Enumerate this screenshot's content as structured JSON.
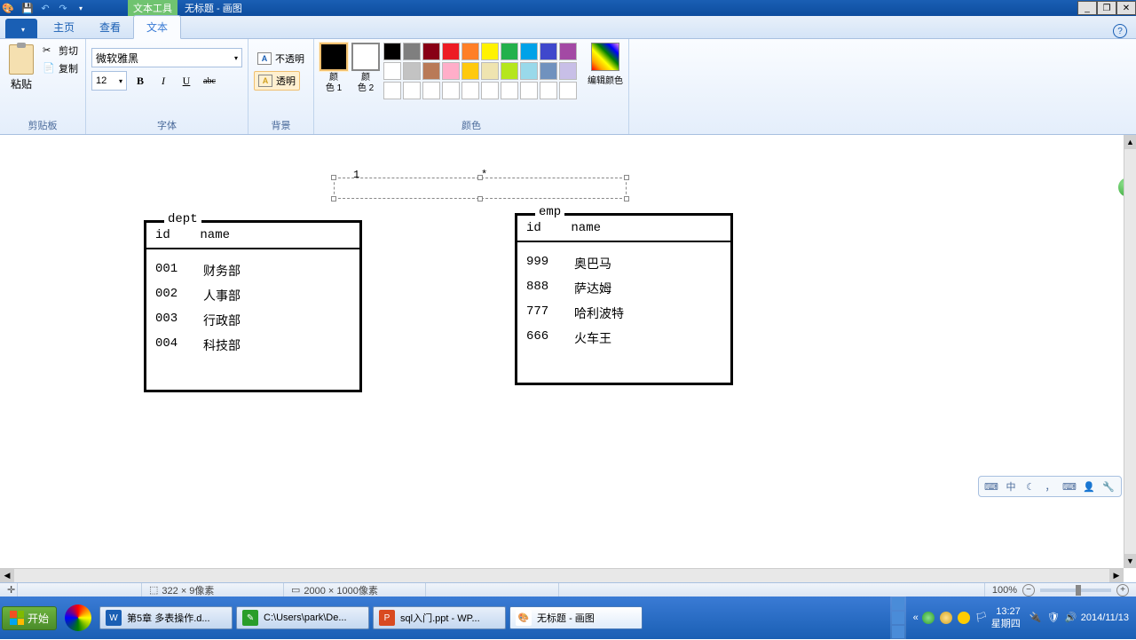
{
  "titlebar": {
    "text_tool": "文本工具",
    "title": "无标题 - 画图"
  },
  "tabs": {
    "home": "主页",
    "view": "查看",
    "text": "文本"
  },
  "clipboard": {
    "paste": "粘贴",
    "cut": "剪切",
    "copy": "复制",
    "label": "剪贴板"
  },
  "font": {
    "family": "微软雅黑",
    "size": "12",
    "label": "字体"
  },
  "bg": {
    "opaque": "不透明",
    "transparent": "透明",
    "label": "背景"
  },
  "colors": {
    "c1": "颜\n色 1",
    "c2": "颜\n色 2",
    "edit": "编辑颜色",
    "label": "颜色"
  },
  "canvas": {
    "rel1": "1",
    "relstar": "*",
    "dept": {
      "title": "dept",
      "header": "id    name",
      "rows": [
        {
          "id": "001",
          "name": "财务部"
        },
        {
          "id": "002",
          "name": "人事部"
        },
        {
          "id": "003",
          "name": "行政部"
        },
        {
          "id": "004",
          "name": "科技部"
        }
      ]
    },
    "emp": {
      "title": "emp",
      "header": "id    name",
      "rows": [
        {
          "id": "999",
          "name": "奥巴马"
        },
        {
          "id": "888",
          "name": "萨达姆"
        },
        {
          "id": "777",
          "name": "哈利波特"
        },
        {
          "id": "666",
          "name": "火车王"
        }
      ]
    }
  },
  "status": {
    "cursor": "",
    "sel": "322 × 9像素",
    "dim": "2000 × 1000像素",
    "zoom": "100%"
  },
  "taskbar": {
    "start": "开始",
    "items": [
      {
        "label": "第5章 多表操作.d...",
        "color": "#1a5fb4",
        "glyph": "W"
      },
      {
        "label": "C:\\Users\\park\\De...",
        "color": "#2a9d2a",
        "glyph": "✎"
      },
      {
        "label": "sql入门.ppt - WP...",
        "color": "#d94a20",
        "glyph": "P"
      },
      {
        "label": "无标题 - 画图",
        "color": "#ffffff",
        "glyph": "🎨"
      }
    ],
    "time": "13:27",
    "day": "星期四",
    "date": "2014/11/13"
  },
  "green": "18"
}
